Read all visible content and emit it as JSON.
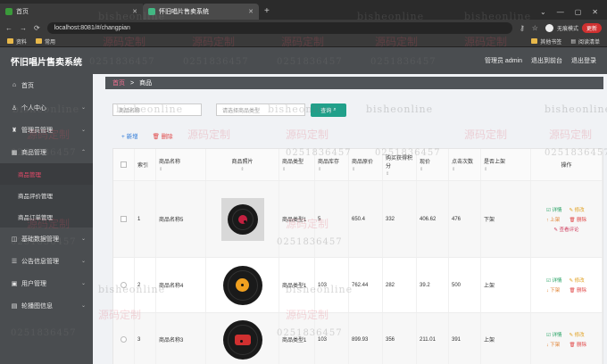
{
  "browser": {
    "tabs": [
      {
        "label": "首页",
        "active": false
      },
      {
        "label": "怀旧唱片售卖系统",
        "active": true
      }
    ],
    "url": "localhost:8081/#/changpian",
    "profile_label": "无痕模式",
    "update_label": "更新",
    "bookmarks": [
      "资料",
      "常用"
    ],
    "bookmarks_right": [
      "其他书签",
      "阅读清单"
    ]
  },
  "app": {
    "title": "怀旧唱片售卖系统",
    "header_links": [
      "管理员 admin",
      "退出到前台",
      "退出登录"
    ]
  },
  "sidebar": {
    "items": [
      {
        "label": "首页",
        "icon": "home-icon"
      },
      {
        "label": "个人中心",
        "icon": "user-icon"
      },
      {
        "label": "管理员管理",
        "icon": "admin-icon"
      },
      {
        "label": "商品管理",
        "icon": "grid-icon"
      }
    ],
    "subitems": [
      {
        "label": "商品管理",
        "active": true
      },
      {
        "label": "商品评价管理",
        "active": false
      },
      {
        "label": "商品订单管理",
        "active": false
      }
    ],
    "items_after": [
      {
        "label": "基础数据管理",
        "icon": "data-icon"
      },
      {
        "label": "公告信息管理",
        "icon": "notice-icon"
      },
      {
        "label": "用户管理",
        "icon": "users-icon"
      },
      {
        "label": "轮播图信息",
        "icon": "image-icon"
      }
    ]
  },
  "breadcrumb": {
    "home": "首页",
    "current": "商品"
  },
  "filters": {
    "name_placeholder": "商品名称",
    "type_placeholder": "请选择商品类型"
  },
  "query_button": "查询",
  "actions": {
    "add": "新增",
    "delete": "删除"
  },
  "table": {
    "headers": [
      "索引",
      "商品名称",
      "商品照片",
      "商品类型",
      "商品库存",
      "商品原价",
      "购买获得积分",
      "现价",
      "点击次数",
      "是否上架",
      "操作"
    ],
    "rows": [
      {
        "index": "1",
        "name": "商品名称5",
        "type": "商品类型1",
        "stock": "5",
        "orig_price": "650.4",
        "points": "332",
        "price": "406.62",
        "clicks": "476",
        "status": "下架",
        "label_color": "#c42040"
      },
      {
        "index": "2",
        "name": "商品名称4",
        "type": "商品类型1",
        "stock": "103",
        "orig_price": "762.44",
        "points": "282",
        "price": "39.2",
        "clicks": "500",
        "status": "上架",
        "label_color": "#f0a020"
      },
      {
        "index": "3",
        "name": "商品名称3",
        "type": "商品类型1",
        "stock": "103",
        "orig_price": "899.93",
        "points": "356",
        "price": "211.01",
        "clicks": "391",
        "status": "上架",
        "label_color": "#d03030"
      }
    ],
    "ops": {
      "detail": "详情",
      "edit": "修改",
      "toggle_off": "下架",
      "toggle_on": "上架",
      "delete": "删除",
      "comments": "查看评论"
    }
  },
  "watermarks": {
    "a": "源码定制",
    "b": "bisheonline",
    "c": "0251836457"
  }
}
